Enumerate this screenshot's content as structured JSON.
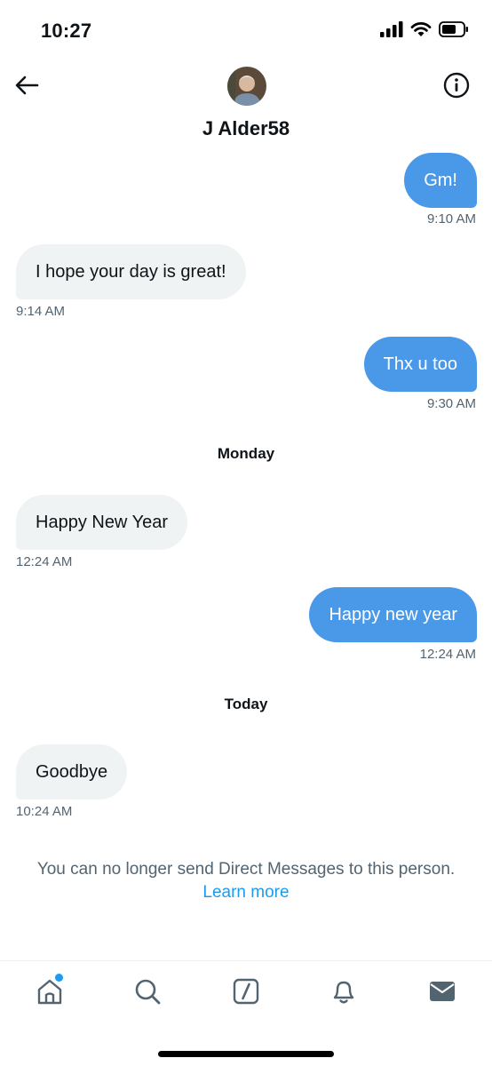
{
  "status_bar": {
    "time": "10:27"
  },
  "header": {
    "contact_name": "J Alder58"
  },
  "messages": [
    {
      "side": "sent",
      "text": "Gm!",
      "time": "9:10 AM"
    },
    {
      "side": "received",
      "text": "I hope your day is great!",
      "time": "9:14 AM"
    },
    {
      "side": "sent",
      "text": "Thx u too",
      "time": "9:30 AM"
    },
    {
      "side": "received",
      "text": "Happy New Year",
      "time": "12:24 AM"
    },
    {
      "side": "sent",
      "text": "Happy new year",
      "time": "12:24 AM"
    },
    {
      "side": "received",
      "text": "Goodbye",
      "time": "10:24 AM"
    }
  ],
  "day_separators": [
    "Monday",
    "Today"
  ],
  "notice": {
    "text": "You can no longer send Direct Messages to this person.",
    "link": "Learn more"
  },
  "colors": {
    "sent_bubble": "#4a99e9",
    "received_bubble": "#eff3f4",
    "link": "#1d9bf0",
    "muted_text": "#536471"
  },
  "icons": {
    "header": [
      "back-arrow-icon",
      "info-icon"
    ],
    "status": [
      "signal-icon",
      "wifi-icon",
      "battery-icon"
    ],
    "nav": [
      "home-icon",
      "search-icon",
      "compose-icon",
      "bell-icon",
      "mail-icon"
    ]
  }
}
